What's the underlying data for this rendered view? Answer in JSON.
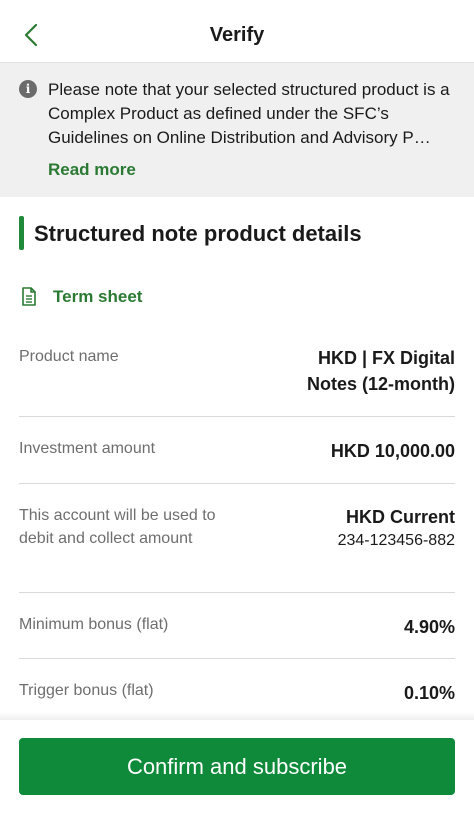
{
  "header": {
    "title": "Verify",
    "back_icon": "chevron-left-icon"
  },
  "notice": {
    "icon": "info-icon",
    "text": "Please note that your selected structured product is a Complex Product as defined under the SFC’s Guidelines on Online Distribution and Advisory P…",
    "read_more": "Read more"
  },
  "section": {
    "title": "Structured note product details"
  },
  "term_sheet": {
    "label": "Term sheet",
    "icon": "document-icon"
  },
  "details": [
    {
      "label": "Product name",
      "value": "HKD | FX Digital Notes (12-month)"
    },
    {
      "label": "Investment amount",
      "value": "HKD 10,000.00"
    },
    {
      "label": "This account will be used to debit and collect amount",
      "value": "HKD Current",
      "subvalue": "234-123456-882"
    },
    {
      "label": "Minimum bonus (flat)",
      "value": "4.90%"
    },
    {
      "label": "Trigger bonus (flat)",
      "value": "0.10%"
    }
  ],
  "footer": {
    "confirm_label": "Confirm and subscribe"
  },
  "colors": {
    "accent": "#0e8a3a",
    "link": "#2b7a33",
    "notice_bg": "#f0f0f0"
  }
}
